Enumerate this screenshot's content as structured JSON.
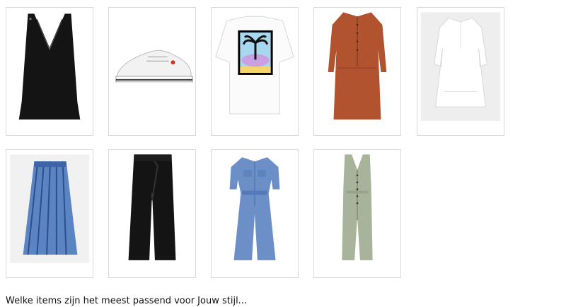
{
  "products": [
    {
      "name": "black-v-neck-cami-top",
      "icon": "black-top-image"
    },
    {
      "name": "white-platform-sneakers",
      "icon": "white-sneaker-image"
    },
    {
      "name": "white-graphic-tshirt",
      "icon": "graphic-tshirt-image"
    },
    {
      "name": "rust-shirt-dress",
      "icon": "rust-dress-image"
    },
    {
      "name": "white-boho-dress",
      "icon": "white-dress-image"
    },
    {
      "name": "blue-striped-skirt",
      "icon": "striped-skirt-image"
    },
    {
      "name": "black-wide-trousers",
      "icon": "black-trousers-image"
    },
    {
      "name": "blue-jumpsuit",
      "icon": "blue-jumpsuit-image"
    },
    {
      "name": "sage-button-jumpsuit",
      "icon": "sage-jumpsuit-image"
    }
  ],
  "question": {
    "text": "Welke items zijn het meest passend voor Jouw stijl..."
  },
  "colors": {
    "card_border": "#d9d9d9",
    "black": "#141414",
    "rust": "#b2532f",
    "blue": "#5b85c2",
    "sage": "#a8b39c"
  }
}
